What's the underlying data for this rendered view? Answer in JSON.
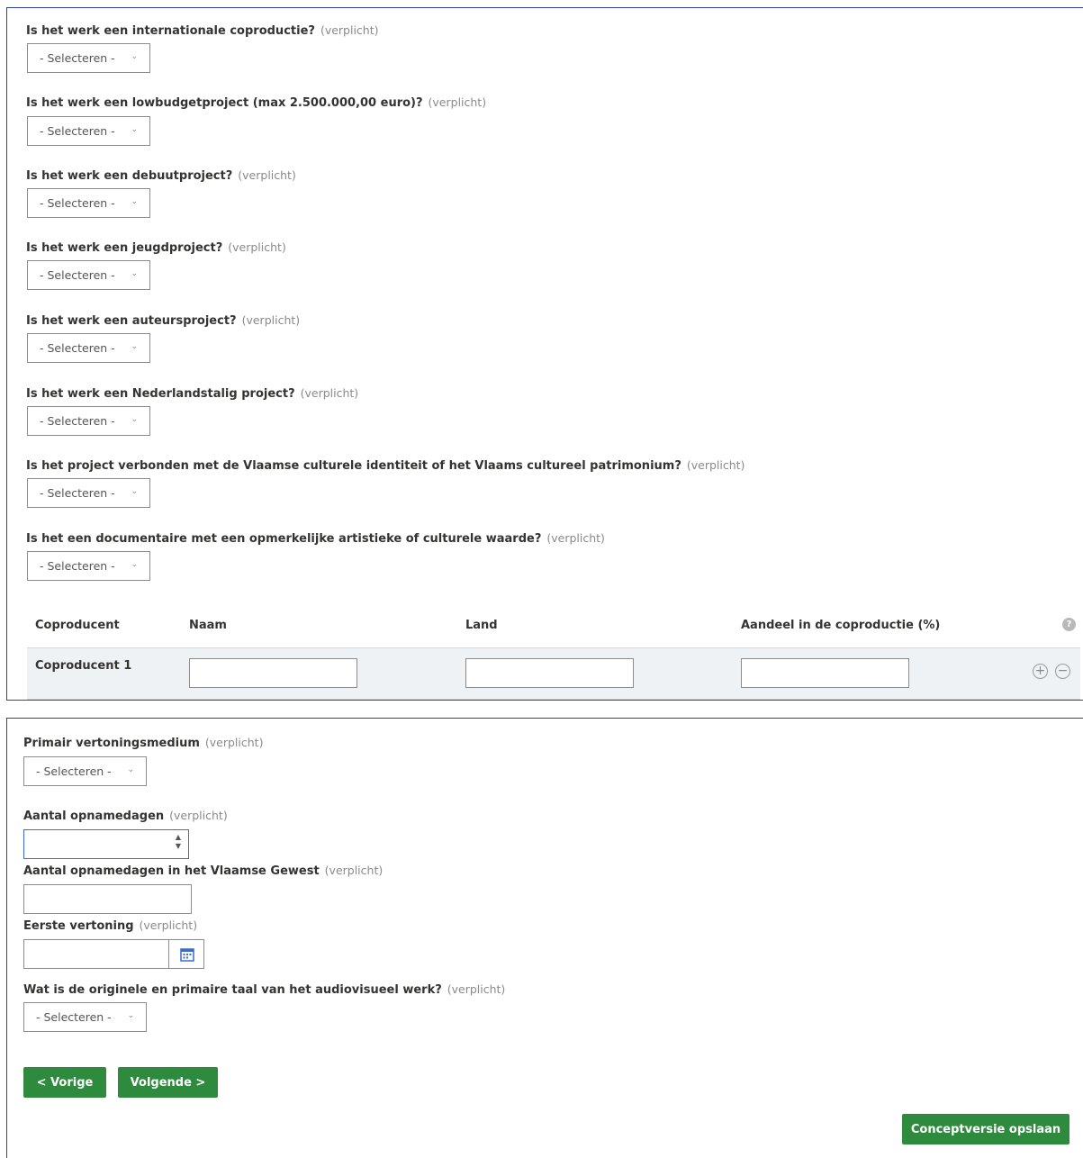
{
  "required_text": "(verplicht)",
  "select_placeholder": "- Selecteren -",
  "questions": [
    "Is het werk een internationale coproductie?",
    "Is het werk een lowbudgetproject (max 2.500.000,00 euro)?",
    "Is het werk een debuutproject?",
    "Is het werk een jeugdproject?",
    "Is het werk een auteursproject?",
    "Is het werk een Nederlandstalig project?",
    "Is het project verbonden met de Vlaamse culturele identiteit of het Vlaams cultureel patrimonium?",
    "Is het een documentaire met een opmerkelijke artistieke of culturele waarde?"
  ],
  "coproducer_table": {
    "headers": [
      "Coproducent",
      "Naam",
      "Land",
      "Aandeel in de coproductie (%)"
    ],
    "help_icon": "?",
    "rows": [
      {
        "label": "Coproducent 1",
        "naam": "",
        "land": "",
        "aandeel": ""
      }
    ],
    "add_icon": "plus-circle-icon",
    "remove_icon": "minus-circle-icon"
  },
  "section2": {
    "primary_medium_label": "Primair vertoningsmedium",
    "shooting_days_label": "Aantal opnamedagen",
    "shooting_days_value": "",
    "shooting_days_flemish_label": "Aantal opnamedagen in het Vlaamse Gewest",
    "shooting_days_flemish_value": "",
    "first_screening_label": "Eerste vertoning",
    "first_screening_value": "",
    "language_label": "Wat is de originele en primaire taal van het audiovisueel werk?"
  },
  "buttons": {
    "prev": "< Vorige",
    "next": "Volgende >",
    "save_draft": "Conceptversie opslaan"
  },
  "colors": {
    "accent_green": "#2e8b3e",
    "panel_border": "#2f3fae",
    "required_gray": "#8a8a8a"
  }
}
